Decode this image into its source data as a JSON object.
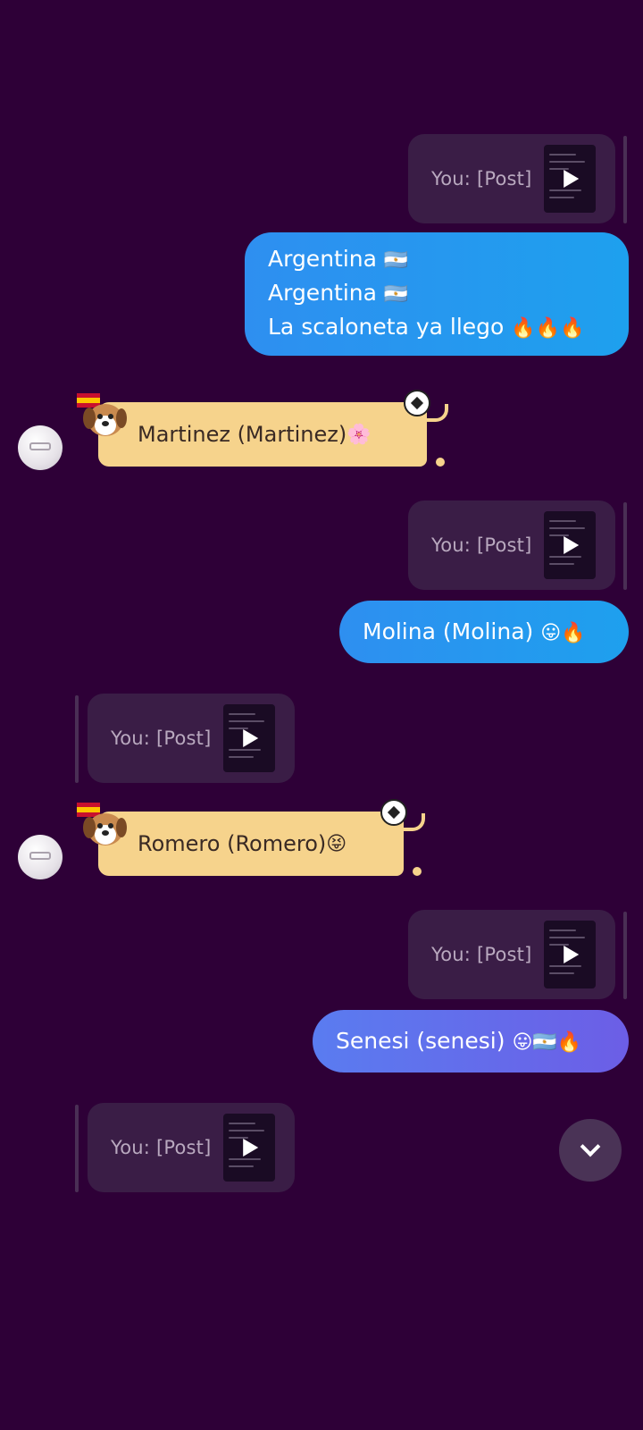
{
  "messages": {
    "post1": {
      "label": "You: [Post]"
    },
    "bubble1": {
      "line1": "Argentina",
      "line1_emoji": "🇦🇷",
      "line2": "Argentina",
      "line2_emoji": "🇦🇷",
      "line3": "La scaloneta ya llego",
      "line3_emoji": "🔥🔥🔥"
    },
    "recv1": {
      "text": "Martinez (Martinez)",
      "emoji": "🌸"
    },
    "post2": {
      "label": "You: [Post]"
    },
    "bubble2": {
      "text": "Molina (Molina)",
      "emoji": "😛🔥"
    },
    "post3": {
      "label": "You: [Post]"
    },
    "recv2": {
      "text": "Romero (Romero)",
      "emoji": "😝"
    },
    "post4": {
      "label": "You: [Post]"
    },
    "bubble3": {
      "text": "Senesi (senesi)",
      "emoji": "😛🇦🇷🔥"
    },
    "post5": {
      "label": "You: [Post]"
    }
  },
  "icons": {
    "play": "play-icon",
    "scroll": "chevron-down-icon",
    "sticker_dog": "dog-sticker-icon",
    "sticker_ball": "soccer-ball-icon"
  },
  "colors": {
    "background": "#2e0037",
    "my_bubble_blue": "#1e96f0",
    "my_bubble_violet": "#6c5ee6",
    "received_bubble": "#f6d38c",
    "post_card": "#3a1d46"
  }
}
